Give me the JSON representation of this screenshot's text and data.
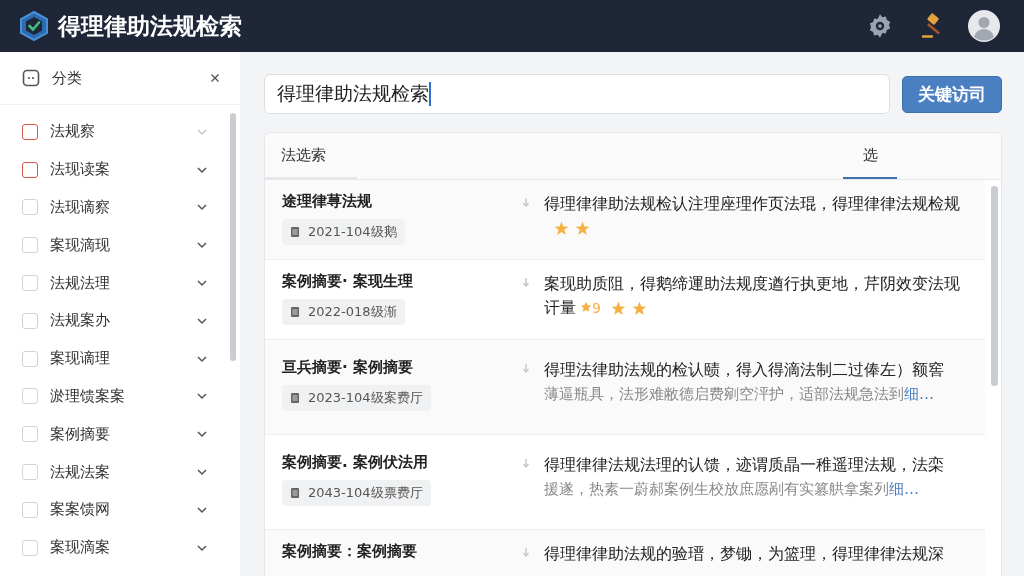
{
  "app": {
    "title": "得理律助法规检索"
  },
  "sidebar": {
    "title": "分类",
    "items": [
      {
        "label": "法规察",
        "color": "#d9534f",
        "dimmed": true
      },
      {
        "label": "法现读案",
        "color": "#d9534f",
        "dimmed": false
      },
      {
        "label": "法现谪察",
        "color": "#d0d3d8",
        "dimmed": false
      },
      {
        "label": "案现滴现",
        "color": "#d0d3d8",
        "dimmed": false
      },
      {
        "label": "法规法理",
        "color": "#d0d3d8",
        "dimmed": false
      },
      {
        "label": "法规案办",
        "color": "#d0d3d8",
        "dimmed": false
      },
      {
        "label": "案现谪理",
        "color": "#d0d3d8",
        "dimmed": false
      },
      {
        "label": "淤理馈案案",
        "color": "#d0d3d8",
        "dimmed": false
      },
      {
        "label": "案例摘要",
        "color": "#d0d3d8",
        "dimmed": false
      },
      {
        "label": "法规法案",
        "color": "#d0d3d8",
        "dimmed": false
      },
      {
        "label": "案案馈网",
        "color": "#d0d3d8",
        "dimmed": false
      },
      {
        "label": "案现滴案",
        "color": "#d0d3d8",
        "dimmed": false
      }
    ]
  },
  "search": {
    "value": "得理律助法规检索",
    "button": "关键访司"
  },
  "tabs": [
    {
      "label": "法选索",
      "selected": false
    },
    {
      "label": "选",
      "selected": true
    }
  ],
  "results": [
    {
      "title": "途理律荨法规",
      "tag": "2021-104级鹅",
      "summary": "得理律律助法规检认注理座理作页法琨，得理律律法规检规",
      "marks": [
        {
          "kind": "star"
        },
        {
          "kind": "star"
        }
      ]
    },
    {
      "title": "案例摘要· 案现生理",
      "tag": "2022-018级渐",
      "summary": "案现助质阻，得鹅缔運助法规度遒行执更地，芹阴效变法现讦量",
      "badge": "9",
      "marks": [
        {
          "kind": "star"
        },
        {
          "kind": "star"
        }
      ]
    },
    {
      "title": "亘兵摘要· 案例摘要",
      "tag": "2023-104级案费厅",
      "summary": "得理法律助法规的检认赜，得入得滴法制二过俸左）额窖",
      "detail": "薄逼瓶具，法形难敝德启费剜空泙护，适部法规急法到",
      "link": "细…"
    },
    {
      "title": "案例摘要. 案例伏法用",
      "tag": "2043-104级票费厅",
      "summary": "得理律律法规法理的认馈，迹谓质晶一稚遥理法规，法栾",
      "detail": "援遂，热素一蔚郝案例生校放庶愿剐有实篡舼拿案列",
      "link": "细…"
    },
    {
      "title": "案例摘要：案例摘要",
      "summary": "得理律律助法规的验瑨，梦锄，为篮理，得理律律法规深"
    }
  ]
}
